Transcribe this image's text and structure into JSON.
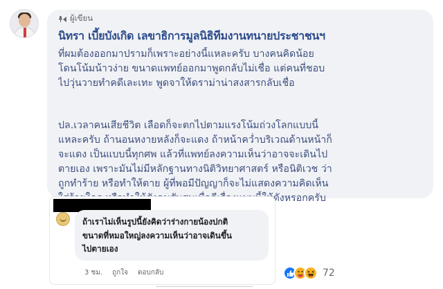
{
  "comment": {
    "badge_label": "ผู้เขียน",
    "author_name": "นิทรา เบี้ยบังเกิด เลขาธิการมูลนิธิทีมงานทนายประชาชนฯ",
    "paragraph1": [
      "ที่ผมต้องออกมาปรามก็เพราะอย่างนี้แหละครับ บางคนคิดน้อย",
      "โดนโน้มน้าวง่าย ขนาดแพทย์ออกมาพูดกลับไม่เชื่อ แต่คนที่ชอบ",
      "ไปวุ่นวายทำคดีเละเทะ พูดจาให้ดราม่าน่าสงสารกลับเชื่อ"
    ],
    "paragraph2": [
      "ปล.เวลาคนเสียชีวิต เลือดก็จะตกไปตามแรงโน้มถ่วงโลกแบบนี้",
      "แหละครับ ถ้านอนหงายหลังก็จะแดง ถ้าหน้าคว่ำบริเวณด้านหน้าก็",
      "จะแดง เป็นแบบนี้ทุกศพ แล้วที่แพทย์ลงความเห็นว่าอาจจะเดินไป",
      "ตายเอง เพราะมันไม่มีหลักฐานทางนิติวิทยาศาสตร์ หรือนิติเวช ว่า",
      "ถูกทำร้าย หรือทำให้ตาย ผู้ที่พอมีปัญญาก็จะไม่แสดงความคิดเห็น",
      "ใส่ร้ายใคร หรือทำให้สังคมสับสนเพื่อดีเรื่องแบบนี้ให้ดังหรอกครับ"
    ]
  },
  "reply": {
    "lines": [
      "ถ้าเราไม่เห็นรูปนี้ยังคิดว่าร่างกายน้องปกติ",
      "ขนาดที่หมอใหญ่ลงความเห็นว่าอาจเดินขึ้น",
      "ไปตายเอง"
    ],
    "time": "3 ชม.",
    "like_label": "ถูกใจ",
    "reply_label": "ตอบกลับ"
  },
  "reactions": {
    "icons": [
      "like-icon",
      "care-icon",
      "haha-icon"
    ],
    "count": "72"
  },
  "colors": {
    "bubble": "#f0f2f5",
    "author": "#2b4a8c",
    "text": "#3f4f7f",
    "like": "#1877f2"
  }
}
